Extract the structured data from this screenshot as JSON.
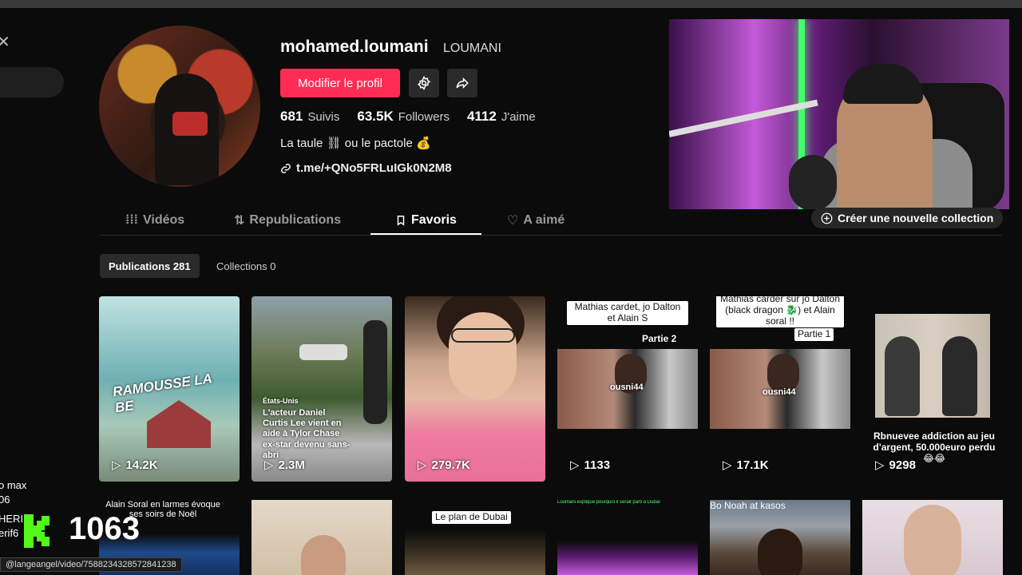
{
  "profile": {
    "username": "mohamed.loumani",
    "nickname": "LOUMANI",
    "edit_label": "Modifier le profil",
    "stats": [
      {
        "value": "681",
        "label": "Suivis"
      },
      {
        "value": "63.5K",
        "label": "Followers"
      },
      {
        "value": "4112",
        "label": "J'aime"
      }
    ],
    "bio": "La taule ⛓ ou le pactole 💰",
    "link": "t.me/+QNo5FRLuIGk0N2M8"
  },
  "tabs": [
    {
      "label": "Vidéos",
      "icon": "grid-icon"
    },
    {
      "label": "Republications",
      "icon": "repost-icon"
    },
    {
      "label": "Favoris",
      "icon": "bookmark-icon"
    },
    {
      "label": "A aimé",
      "icon": "heart-icon"
    }
  ],
  "new_collection_label": "Créer une nouvelle collection",
  "subtabs": {
    "publications": "Publications 281",
    "collections": "Collections 0"
  },
  "videos": [
    {
      "views": "14.2K",
      "overlay": "RAMOUSSE LA BE"
    },
    {
      "views": "2.3M",
      "tag": "États-Unis",
      "overlay": "L'acteur Daniel Curtis Lee vient en aide à Tylor Chase ex-star devenu sans-abri"
    },
    {
      "views": "279.7K"
    },
    {
      "views": "1133",
      "caption": "Mathias cardet, jo Dalton et Alain S",
      "part": "Partie 2",
      "handle": "ousni44"
    },
    {
      "views": "17.1K",
      "caption": "Mathias carder sur jo Dalton (black dragon 🐉) et Alain soral !!",
      "part": "Partie 1",
      "handle": "ousni44"
    },
    {
      "views": "9298",
      "caption": "Rbnuevee addiction au jeu d'argent, 50.000euro perdu 😂😂"
    }
  ],
  "row2": [
    {
      "caption": "Alain Soral en larmes évoque ses soirs de Noël"
    },
    {},
    {
      "caption": "Le plan de Dubai"
    },
    {
      "caption": "Loumani explique pourquoi il serait parti à Dubaï"
    },
    {
      "caption": "Bo Noah at kasos"
    },
    {}
  ],
  "stream_overlay": {
    "counter": "1063",
    "side_lines": [
      "o max",
      "06",
      "HERI",
      "erif6"
    ]
  },
  "status_url": "@langeangel/video/7588234328572841238",
  "colors": {
    "accent": "#fe2c55",
    "background": "#0b0b0b",
    "k_logo": "#53fc18"
  }
}
